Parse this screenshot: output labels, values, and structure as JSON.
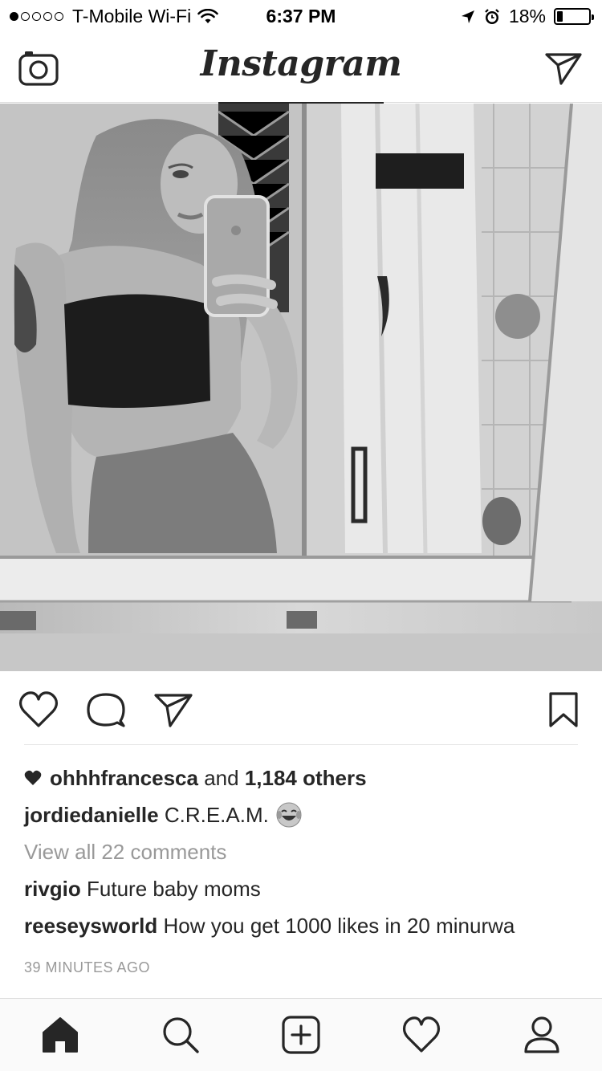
{
  "status_bar": {
    "carrier": "T-Mobile Wi-Fi",
    "time": "6:37 PM",
    "battery": "18%",
    "battery_level": 0.18,
    "signal_bars_filled": 1,
    "signal_bars_total": 5
  },
  "nav": {
    "title": "Instagram",
    "left_icon": "camera-icon",
    "right_icon": "direct-send-icon"
  },
  "post": {
    "photo_alt": "",
    "actions": {
      "like_icon": "heart-outline-icon",
      "comment_icon": "comment-bubble-icon",
      "share_icon": "paper-plane-icon",
      "save_icon": "bookmark-icon"
    },
    "likes": {
      "user": "ohhhfrancesca",
      "connector": "and",
      "others": "1,184 others"
    },
    "caption": {
      "user": "jordiedanielle",
      "text": "C.R.E.A.M.",
      "emoji": "face-with-tears-of-joy-emoji"
    },
    "view_all": "View all 22 comments",
    "comments": [
      {
        "user": "rivgio",
        "text": "Future baby moms"
      },
      {
        "user": "reeseysworld",
        "text": "How you get 1000 likes in 20 minurwa"
      }
    ],
    "timestamp": "39 MINUTES AGO"
  },
  "tab_bar": {
    "items": [
      {
        "name": "home",
        "icon": "home-filled-icon",
        "active": true
      },
      {
        "name": "search",
        "icon": "search-icon",
        "active": false
      },
      {
        "name": "add",
        "icon": "add-square-icon",
        "active": false
      },
      {
        "name": "activity",
        "icon": "heart-outline-icon",
        "active": false
      },
      {
        "name": "profile",
        "icon": "person-icon",
        "active": false
      }
    ]
  },
  "colors": {
    "text": "#262626",
    "muted": "#999999",
    "border": "#dbdbdb",
    "tabbar_bg": "#fafafa"
  }
}
